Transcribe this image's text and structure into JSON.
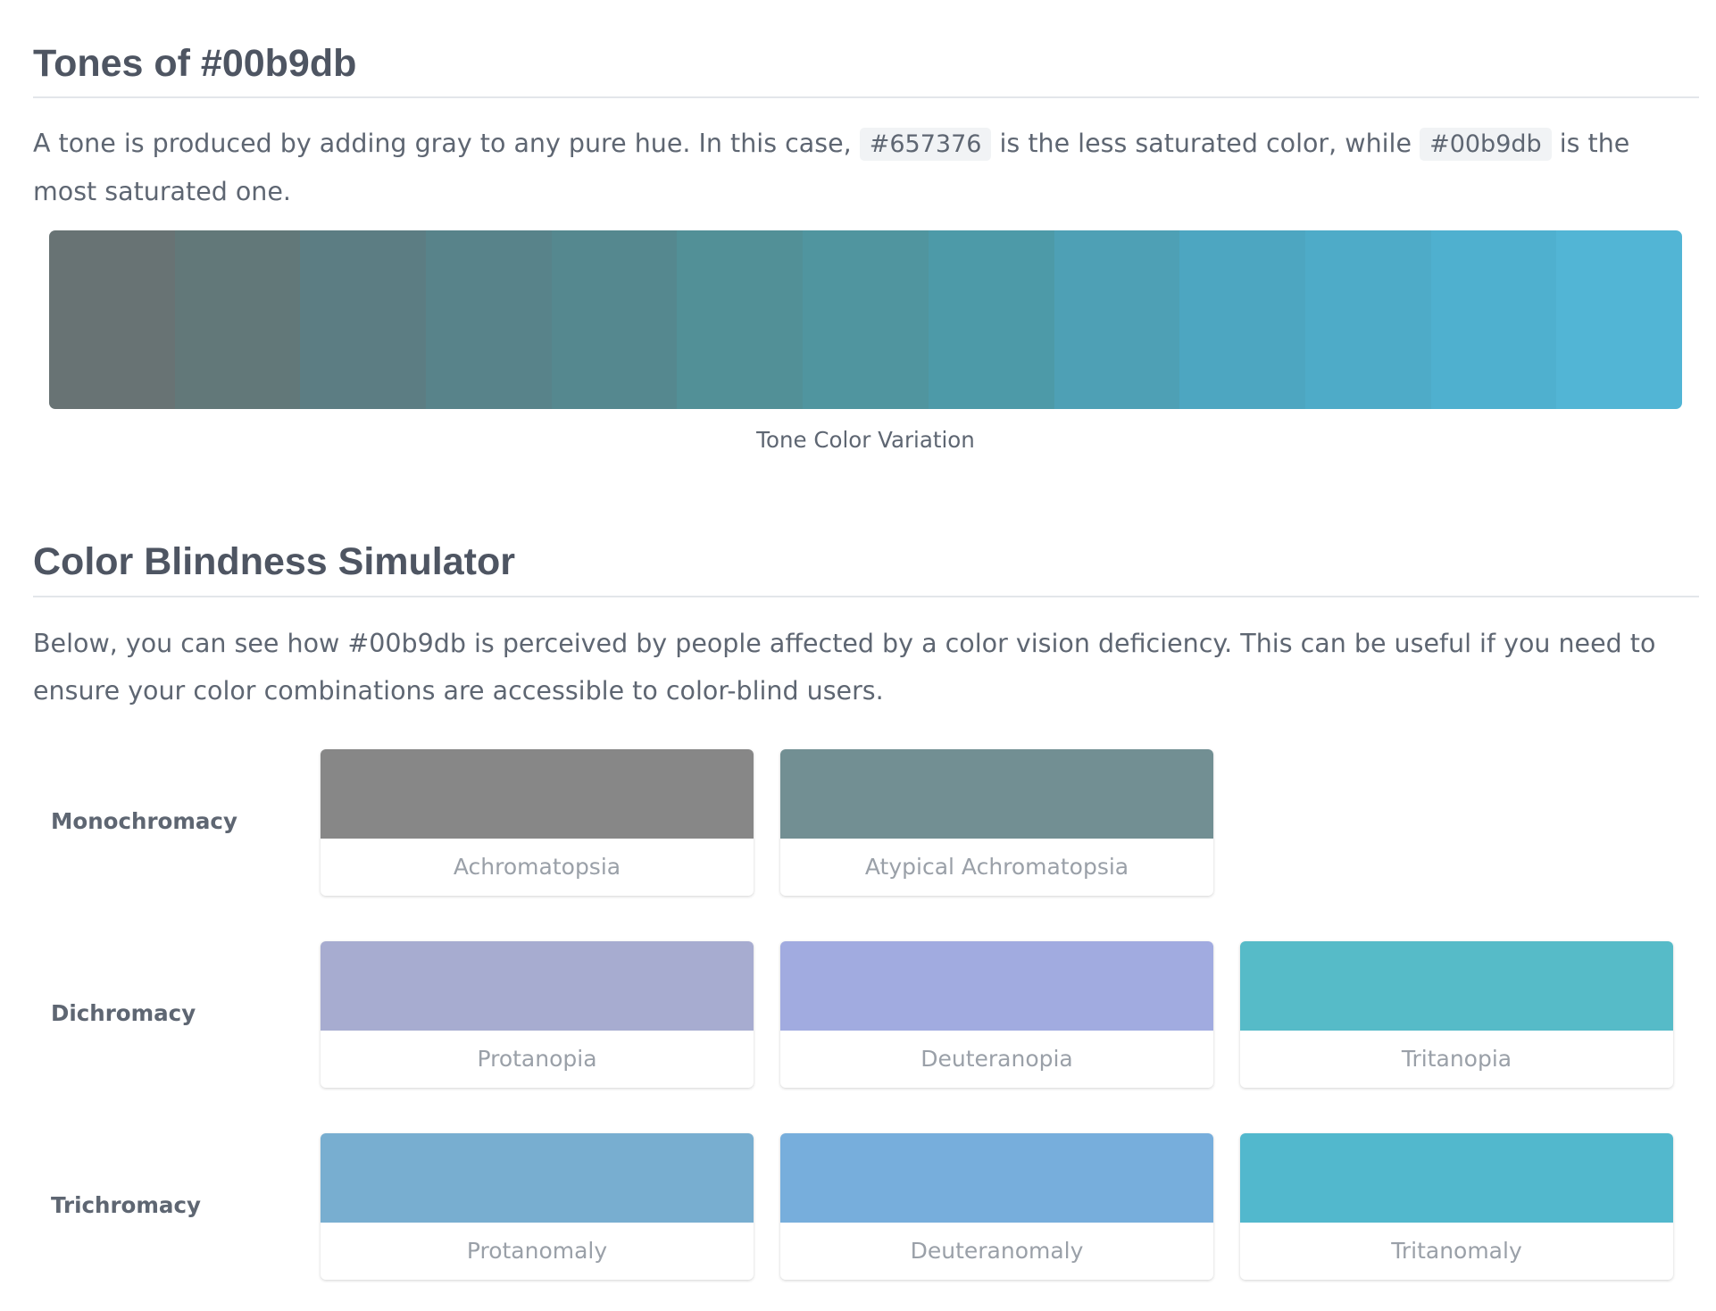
{
  "tones": {
    "title": "Tones of #00b9db",
    "desc_before": "A tone is produced by adding gray to any pure hue. In this case, ",
    "hex_least": "#657376",
    "desc_middle": " is the less saturated color, while ",
    "hex_most": "#00b9db",
    "desc_after": " is the most saturated one.",
    "caption": "Tone Color Variation",
    "colors": [
      "#687374",
      "#627879",
      "#5c7d83",
      "#58838a",
      "#55888f",
      "#529097",
      "#50959f",
      "#4d9aa8",
      "#4ea0b5",
      "#4da6c1",
      "#4eabc8",
      "#4fb0cf",
      "#52b5d5"
    ]
  },
  "colorblind": {
    "title": "Color Blindness Simulator",
    "desc": "Below, you can see how #00b9db is perceived by people affected by a color vision deficiency. This can be useful if you need to ensure your color combinations are accessible to color-blind users.",
    "rows": [
      {
        "label": "Monochromacy",
        "cards": [
          {
            "label": "Achromatopsia",
            "color": "#878787"
          },
          {
            "label": "Atypical Achromatopsia",
            "color": "#728f93"
          }
        ]
      },
      {
        "label": "Dichromacy",
        "cards": [
          {
            "label": "Protanopia",
            "color": "#a7acd0"
          },
          {
            "label": "Deuteranopia",
            "color": "#a1abe0"
          },
          {
            "label": "Tritanopia",
            "color": "#56bbc8"
          }
        ]
      },
      {
        "label": "Trichromacy",
        "cards": [
          {
            "label": "Protanomaly",
            "color": "#78aed0"
          },
          {
            "label": "Deuteranomaly",
            "color": "#77aedc"
          },
          {
            "label": "Tritanomaly",
            "color": "#52b8cd"
          }
        ]
      }
    ]
  }
}
